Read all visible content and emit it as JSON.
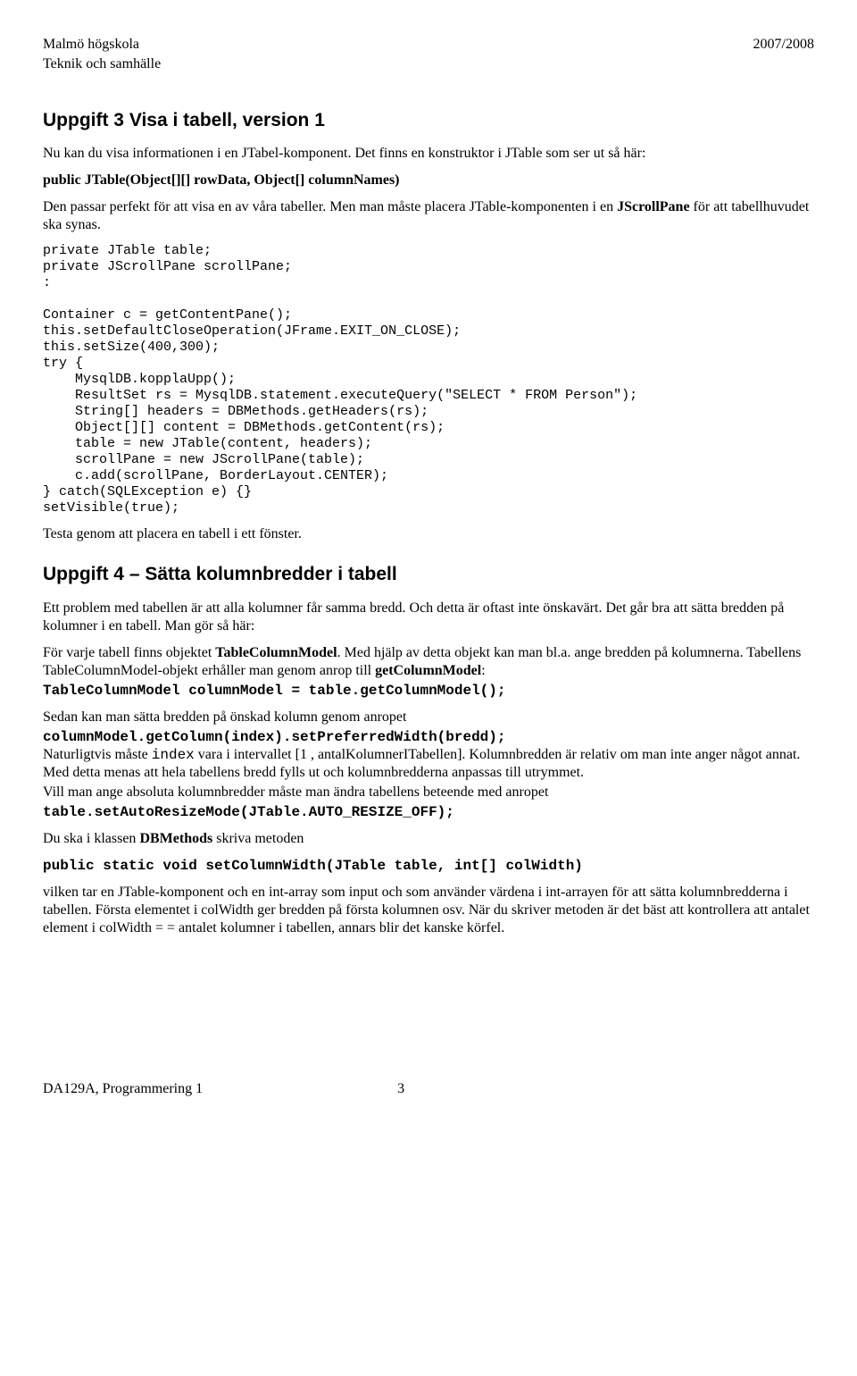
{
  "header": {
    "left1": "Malmö högskola",
    "right": "2007/2008",
    "left2": "Teknik och samhälle"
  },
  "task3": {
    "title": "Uppgift 3 Visa i tabell, version 1",
    "p1": "Nu kan du visa informationen i en JTabel-komponent. Det finns en konstruktor i JTable som ser ut så här:",
    "sig": "public JTable(Object[][] rowData, Object[] columnNames)",
    "p2a": "Den passar perfekt för att visa en av våra tabeller. Men man måste placera JTable-komponenten i en ",
    "p2b": "JScrollPane",
    "p2c": " för att tabellhuvudet ska synas.",
    "code": "private JTable table;\nprivate JScrollPane scrollPane;\n:\n\nContainer c = getContentPane();\nthis.setDefaultCloseOperation(JFrame.EXIT_ON_CLOSE);\nthis.setSize(400,300);\ntry {\n    MysqlDB.kopplaUpp();\n    ResultSet rs = MysqlDB.statement.executeQuery(\"SELECT * FROM Person\");\n    String[] headers = DBMethods.getHeaders(rs);\n    Object[][] content = DBMethods.getContent(rs);\n    table = new JTable(content, headers);\n    scrollPane = new JScrollPane(table);\n    c.add(scrollPane, BorderLayout.CENTER);\n} catch(SQLException e) {}\nsetVisible(true);",
    "p3": "Testa genom att placera en tabell i ett fönster."
  },
  "task4": {
    "title": "Uppgift 4 – Sätta kolumnbredder i tabell",
    "p1": "Ett problem med tabellen är att alla kolumner får samma bredd. Och detta är oftast inte önskavärt. Det går bra att sätta bredden på kolumner i en tabell. Man gör så här:",
    "p2a": "För varje tabell finns objektet ",
    "p2b": "TableColumnModel",
    "p2c": ". Med hjälp av detta objekt kan man bl.a. ange bredden på kolumnerna. Tabellens TableColumnModel-objekt erhåller man genom anrop till ",
    "p2d": "getColumnModel",
    "p2e": ":",
    "codeA": "TableColumnModel columnModel = table.getColumnModel();",
    "p3": "Sedan kan man sätta bredden på önskad kolumn genom anropet",
    "codeB": "columnModel.getColumn(index).setPreferredWidth(bredd);",
    "p4a": "Naturligtvis måste ",
    "p4b": "index",
    "p4c": " vara i intervallet [1 , antalKolumnerITabellen]. Kolumnbredden är relativ om man inte anger något annat. Med detta menas att hela tabellens bredd fylls ut och kolumnbredderna anpassas till utrymmet.",
    "p5": "Vill man ange absoluta kolumnbredder måste man ändra tabellens beteende med anropet",
    "codeC": "table.setAutoResizeMode(JTable.AUTO_RESIZE_OFF);",
    "p6a": "Du ska i klassen ",
    "p6b": "DBMethods",
    "p6c": " skriva metoden",
    "sig": "public static void setColumnWidth(JTable table, int[] colWidth)",
    "p7": "vilken tar en JTable-komponent och en int-array som input och som använder värdena i int-arrayen för att sätta kolumnbredderna i tabellen. Första elementet i colWidth ger bredden på första kolumnen osv. När du skriver metoden är det bäst att kontrollera att antalet element i colWidth = = antalet kolumner i tabellen, annars blir det kanske körfel."
  },
  "footer": {
    "left": "DA129A, Programmering 1",
    "page": "3"
  }
}
